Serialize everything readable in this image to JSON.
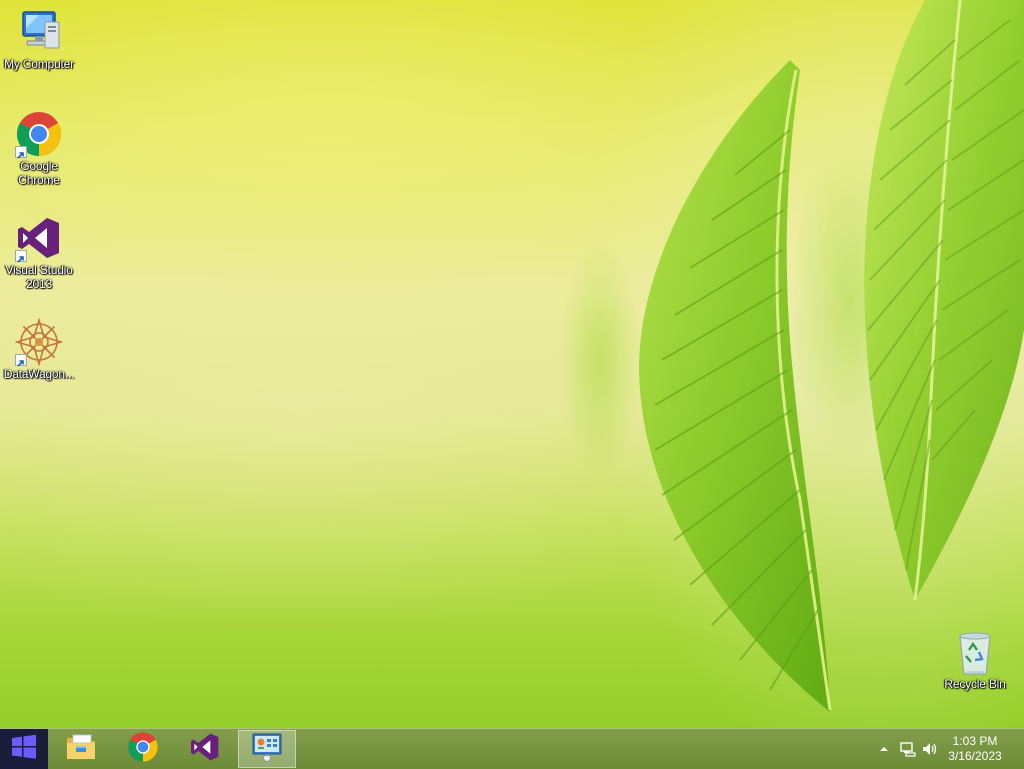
{
  "desktop": {
    "icons": [
      {
        "label": "My Computer",
        "icon": "computer-icon"
      },
      {
        "label": "Google Chrome",
        "icon": "chrome-icon"
      },
      {
        "label": "Visual Studio 2013",
        "icon": "visual-studio-icon"
      },
      {
        "label": "DataWagon...",
        "icon": "datawagon-icon"
      },
      {
        "label": "Recycle Bin",
        "icon": "recycle-bin-icon"
      }
    ]
  },
  "taskbar": {
    "start": {
      "icon": "windows-logo-icon"
    },
    "pinned": [
      {
        "icon": "file-explorer-icon"
      },
      {
        "icon": "chrome-icon"
      },
      {
        "icon": "visual-studio-icon"
      },
      {
        "icon": "control-panel-icon",
        "active": true
      }
    ],
    "tray": {
      "icons": [
        "show-hidden-icons-chevron-icon",
        "network-icon",
        "volume-icon"
      ],
      "time": "1:03 PM",
      "date": "3/16/2023"
    }
  },
  "colors": {
    "taskbar": "#6e8a35",
    "start_button": "#1a1c3a",
    "windows_logo": "#6a5cff",
    "visual_studio": "#68217a",
    "leaf": "#8ccc2a"
  }
}
